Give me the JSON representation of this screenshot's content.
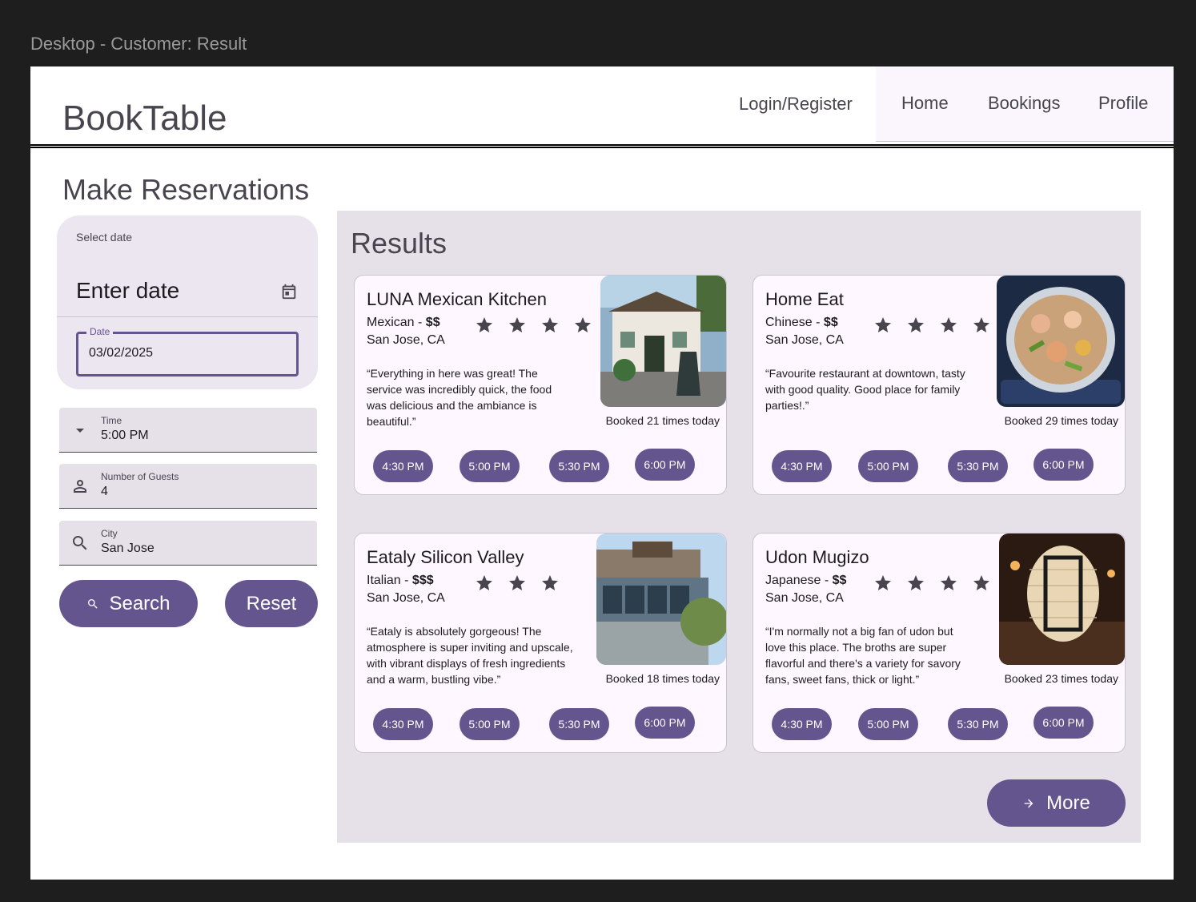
{
  "frame_label": "Desktop - Customer: Result",
  "header": {
    "brand": "BookTable",
    "login": "Login/Register",
    "nav": [
      "Home",
      "Bookings",
      "Profile"
    ]
  },
  "page_title": "Make Reservations",
  "date_picker": {
    "headline": "Select date",
    "main_text": "Enter date",
    "field_label": "Date",
    "field_value": "03/02/2025"
  },
  "filters": {
    "time": {
      "label": "Time",
      "value": "5:00 PM"
    },
    "guests": {
      "label": "Number of Guests",
      "value": "4"
    },
    "city": {
      "label": "City",
      "value": "San Jose"
    }
  },
  "buttons": {
    "search": "Search",
    "reset": "Reset",
    "more": "More"
  },
  "results": {
    "title": "Results",
    "cards": [
      {
        "name": "LUNA Mexican Kitchen",
        "cuisine": "Mexican - ",
        "price": "$$",
        "city": "San Jose, CA",
        "stars": 4,
        "review": "“Everything in here was great! The service was incredibly quick, the food was delicious and the ambiance is beautiful.”",
        "booked": "Booked 21 times today",
        "slots": [
          "4:30 PM",
          "5:00 PM",
          "5:30 PM",
          "6:00 PM"
        ]
      },
      {
        "name": "Home Eat",
        "cuisine": "Chinese - ",
        "price": "$$",
        "city": "San Jose, CA",
        "stars": 4,
        "review": "“Favourite restaurant at downtown, tasty with good quality. Good place for family parties!.”",
        "booked": "Booked 29 times today",
        "slots": [
          "4:30 PM",
          "5:00 PM",
          "5:30 PM",
          "6:00 PM"
        ]
      },
      {
        "name": "Eataly Silicon Valley",
        "cuisine": "Italian - ",
        "price": "$$$",
        "city": "San Jose, CA",
        "stars": 3,
        "review": "“Eataly is absolutely gorgeous! The atmosphere is super inviting and upscale, with vibrant displays of fresh ingredients and a warm, bustling vibe.”",
        "booked": "Booked 18 times today",
        "slots": [
          "4:30 PM",
          "5:00 PM",
          "5:30 PM",
          "6:00 PM"
        ]
      },
      {
        "name": "Udon Mugizo",
        "cuisine": "Japanese - ",
        "price": "$$",
        "city": "San Jose, CA",
        "stars": 4,
        "review": "“I'm normally not a big fan of udon but love this place. The broths are super flavorful and there's a variety for savory fans, sweet fans, thick or light.”",
        "booked": "Booked 23 times today",
        "slots": [
          "4:30 PM",
          "5:00 PM",
          "5:30 PM",
          "6:00 PM"
        ]
      }
    ]
  },
  "colors": {
    "primary": "#65558f",
    "surface": "#fef7ff",
    "panel": "#e6e0e9"
  }
}
